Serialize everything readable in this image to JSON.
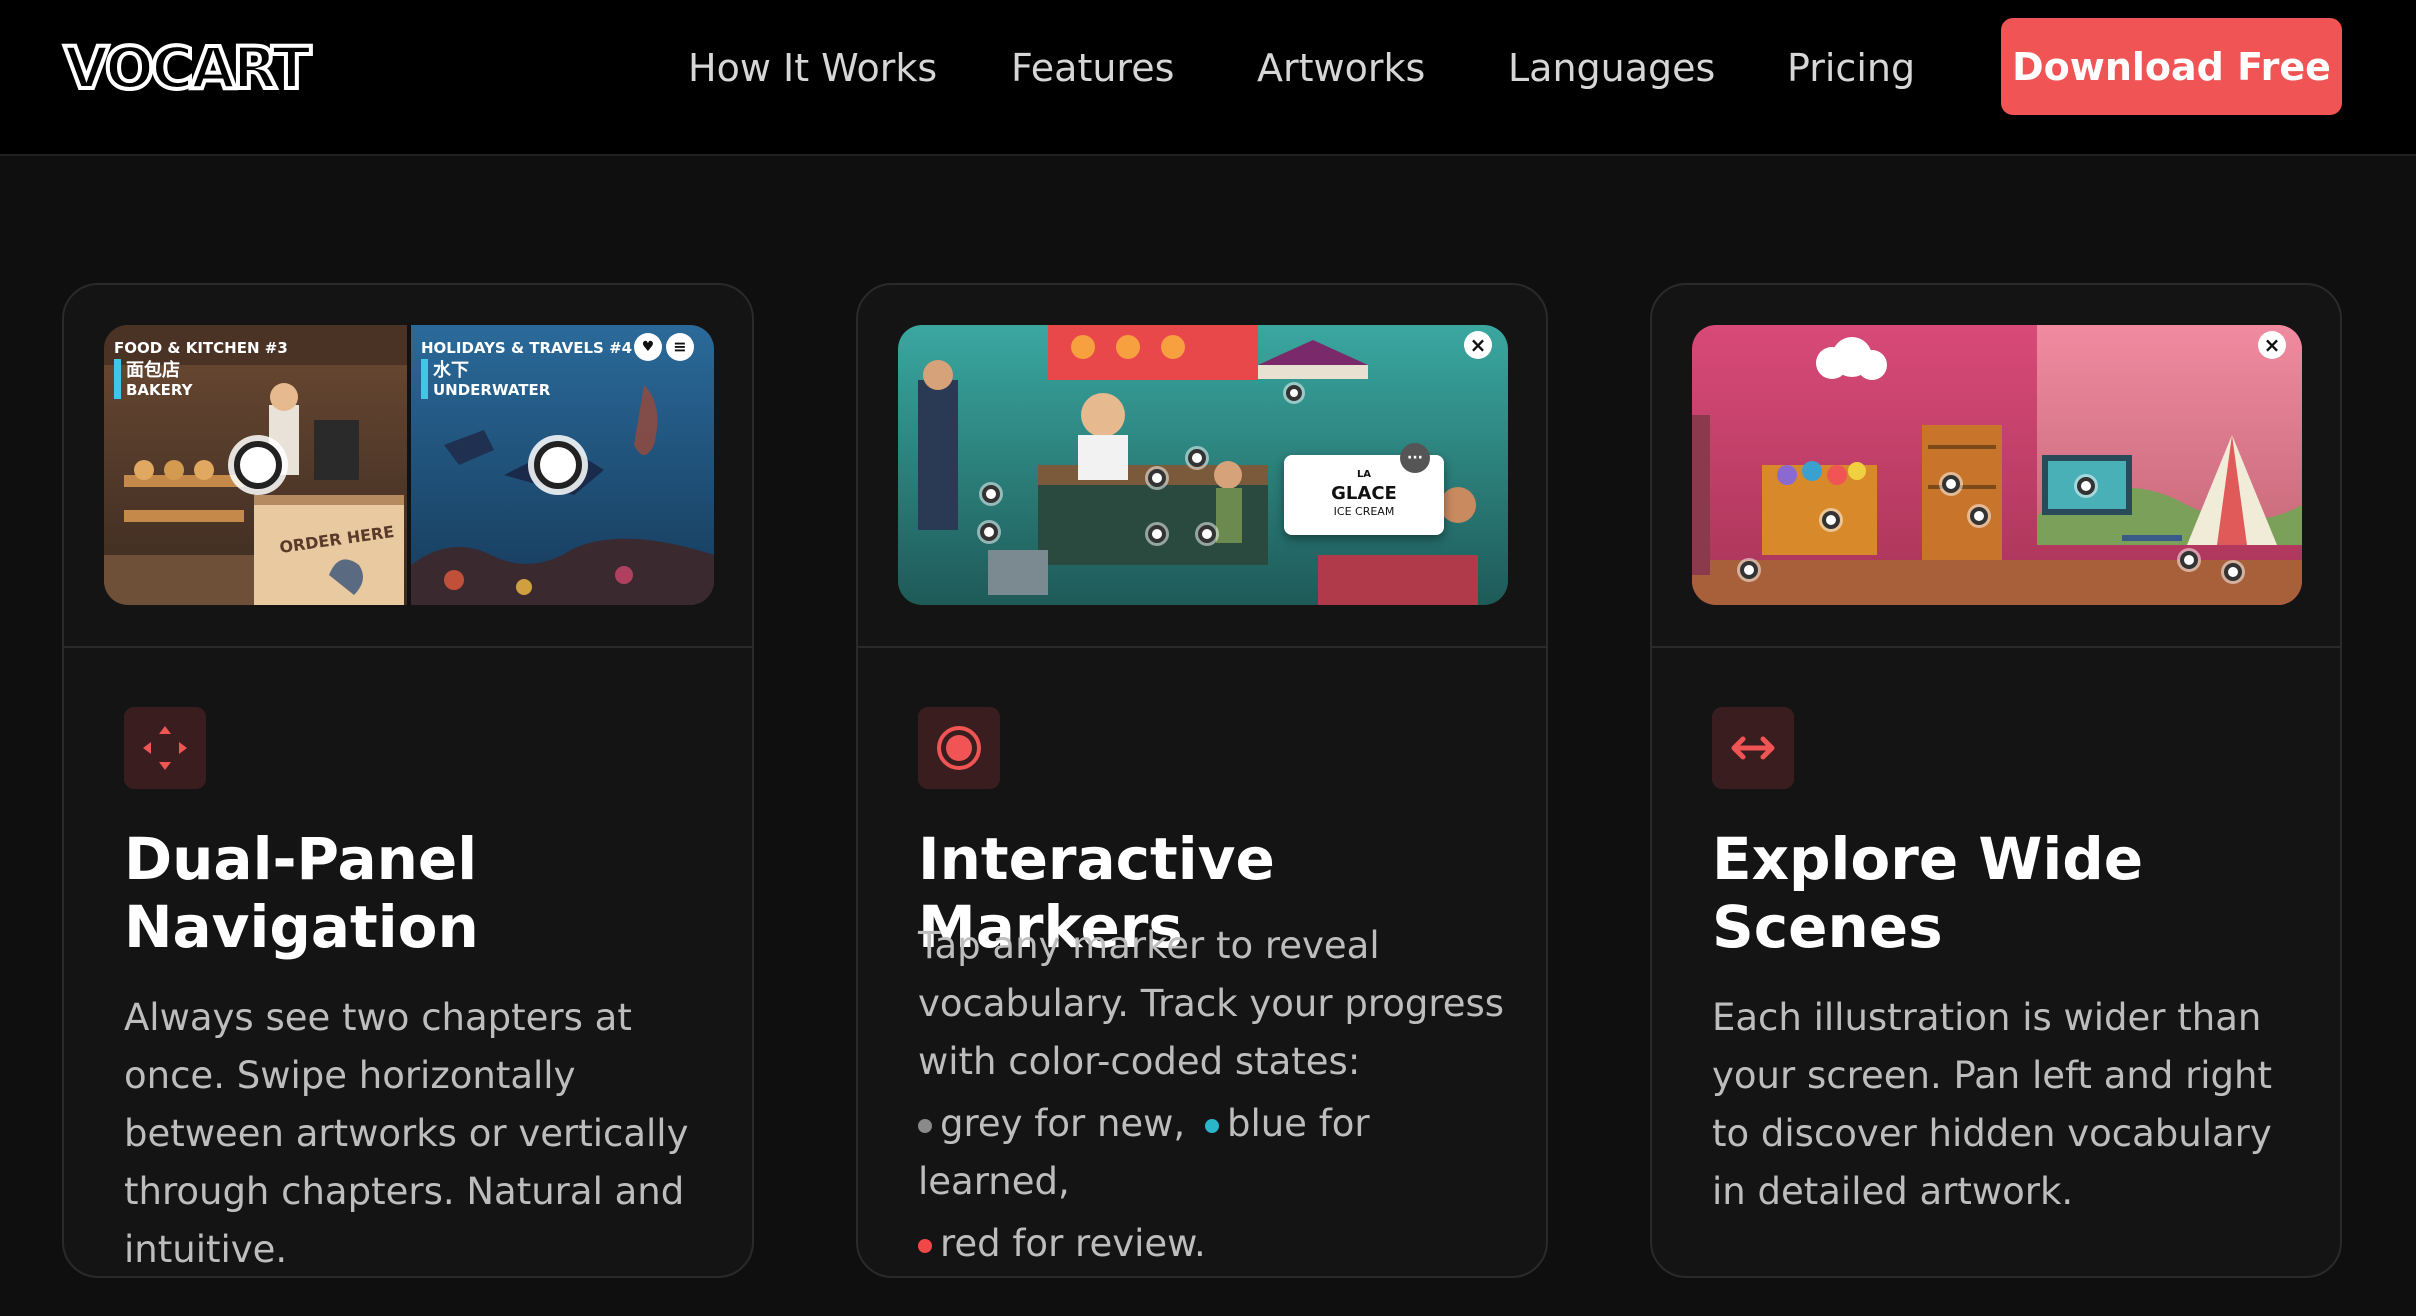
{
  "nav": {
    "logo": "VOCART",
    "links": [
      "How It Works",
      "Features",
      "Artworks",
      "Languages",
      "Pricing"
    ],
    "cta": "Download Free"
  },
  "colors": {
    "accent": "#f05454",
    "background": "#0f0f0f",
    "card": "#141414",
    "marker_grey": "#8a8a8a",
    "marker_blue": "#2bb5c9",
    "marker_red": "#f04848"
  },
  "cards": [
    {
      "icon": "move-arrows-icon",
      "title": "Dual-Panel Navigation",
      "body": "Always see two chapters at once. Swipe horizontally between artworks or vertically through chapters. Natural and intuitive.",
      "panels": [
        {
          "chapter": "FOOD & KITCHEN #3",
          "native": "面包店",
          "word": "BAKERY"
        },
        {
          "chapter": "HOLIDAYS & TRAVELS #4",
          "native": "水下",
          "word": "UNDERWATER"
        }
      ],
      "sign": "ORDER HERE"
    },
    {
      "icon": "record-marker-icon",
      "title": "Interactive Markers",
      "body": "Tap any marker to reveal vocabulary. Track your progress with color-coded states:",
      "states": [
        {
          "label": "grey for new,",
          "color": "#8a8a8a"
        },
        {
          "label": "blue for learned,",
          "color": "#2bb5c9"
        },
        {
          "label": "red for review.",
          "color": "#f04848"
        }
      ],
      "popup": {
        "article": "LA",
        "word": "GLACE",
        "translation": "ICE CREAM"
      }
    },
    {
      "icon": "horizontal-arrows-icon",
      "title": "Explore Wide Scenes",
      "body": "Each illustration is wider than your screen. Pan left and right to discover hidden vocabulary in detailed artwork."
    }
  ]
}
